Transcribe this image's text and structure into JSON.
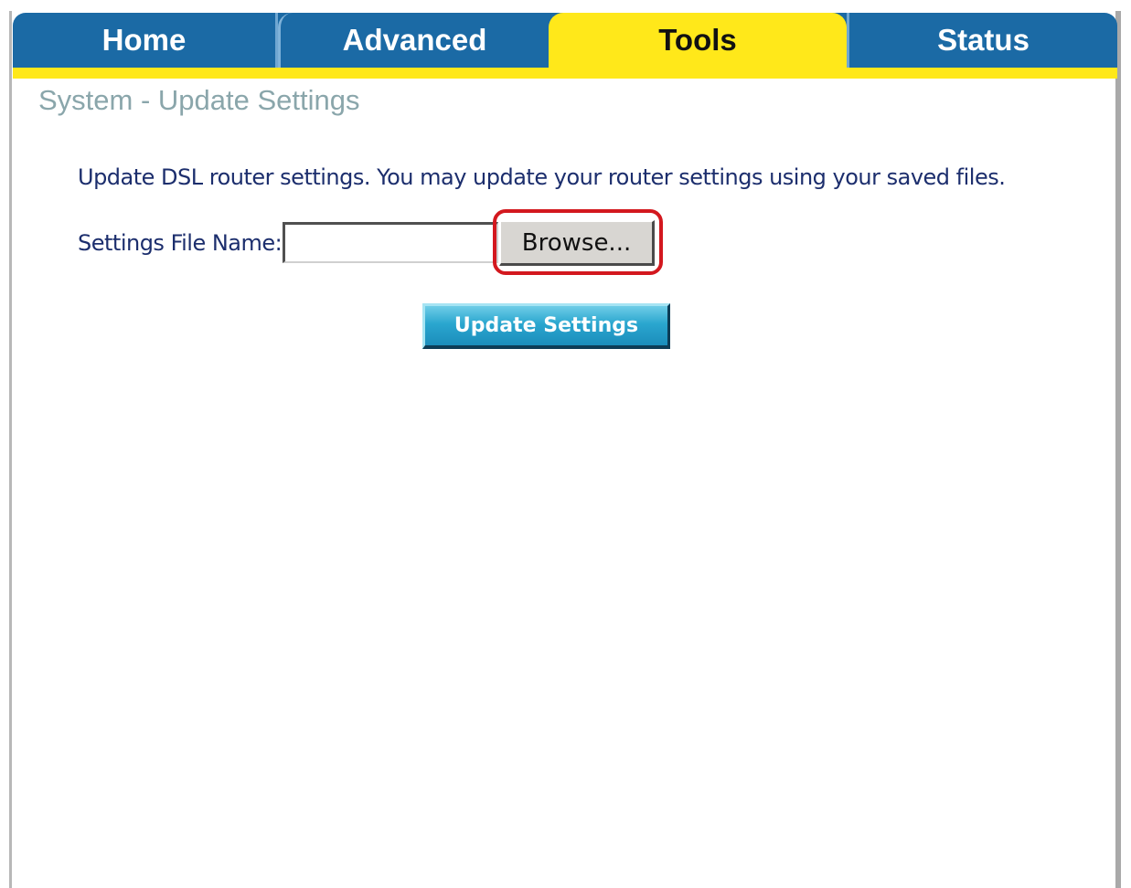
{
  "nav": {
    "tabs": [
      {
        "label": "Home",
        "active": false
      },
      {
        "label": "Advanced",
        "active": false
      },
      {
        "label": "Tools",
        "active": true
      },
      {
        "label": "Status",
        "active": false
      }
    ]
  },
  "page": {
    "title": "System - Update Settings",
    "description": "Update DSL router settings. You may update your router settings using your saved files."
  },
  "form": {
    "file_label": "Settings File Name:",
    "file_value": "",
    "browse_label": "Browse...",
    "submit_label": "Update Settings"
  },
  "colors": {
    "nav_blue": "#1b6aa5",
    "active_tab_yellow": "#ffe81a",
    "title_gray": "#8aa6ab",
    "text_navy": "#1c2e6d",
    "highlight_red": "#d3181e",
    "button_cyan": "#2aa6cf"
  }
}
